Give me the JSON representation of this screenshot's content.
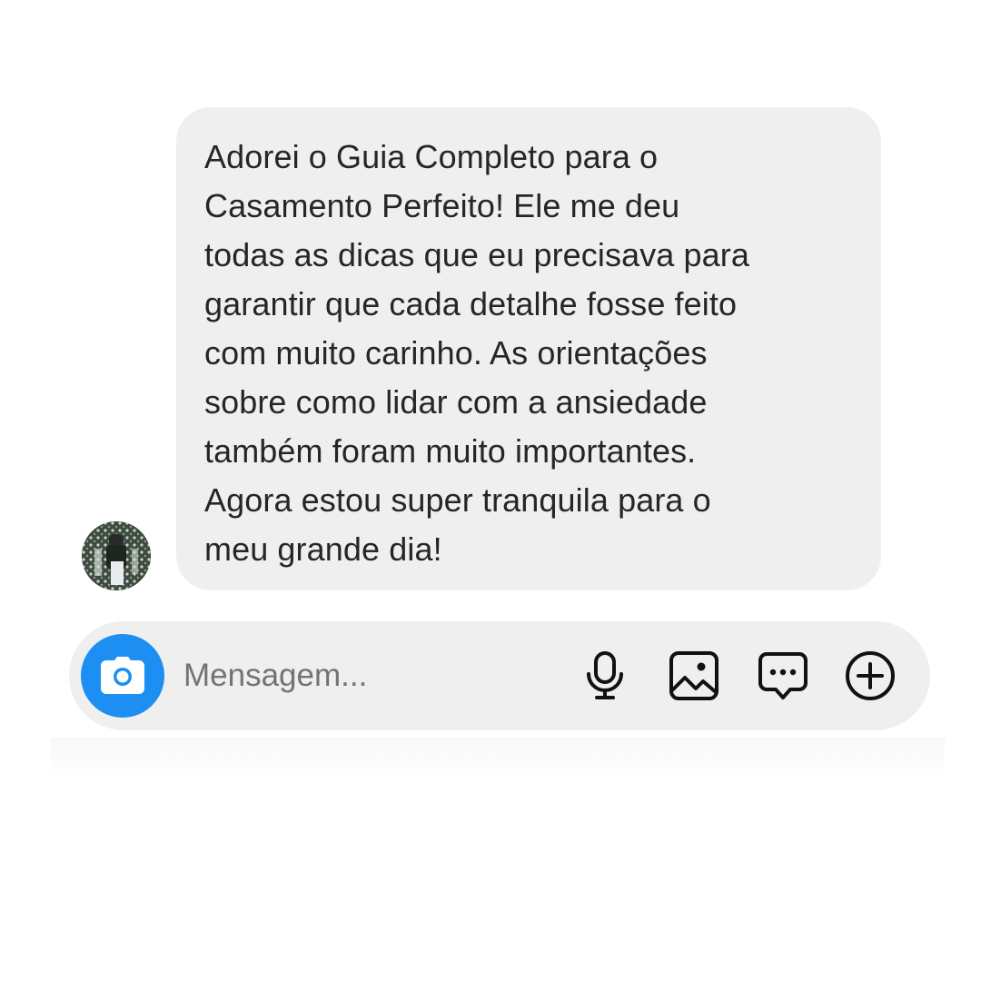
{
  "message": {
    "lines": [
      "Adorei o Guia Completo para o",
      "Casamento Perfeito! Ele me deu",
      "todas as dicas que eu precisava para",
      "garantir que cada detalhe fosse feito",
      "com muito carinho. As orientações",
      "sobre como lidar com a ansiedade",
      "também foram muito importantes.",
      "Agora estou super tranquila para o",
      "meu grande dia!"
    ]
  },
  "composer": {
    "placeholder": "Mensagem..."
  },
  "colors": {
    "accent": "#1d8ff2",
    "bubble": "#efefef",
    "text": "#262626",
    "placeholder": "#737373"
  },
  "icons": [
    "camera-icon",
    "microphone-icon",
    "image-icon",
    "sticker-icon",
    "plus-icon"
  ]
}
